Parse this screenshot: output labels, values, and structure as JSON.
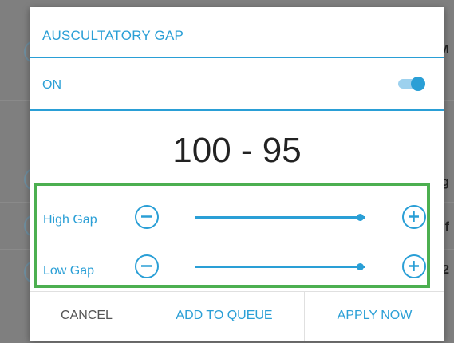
{
  "dialog": {
    "title": "AUSCULTATORY GAP",
    "toggle_label": "ON",
    "toggle_on": true,
    "value_text": "100 - 95",
    "high_gap": {
      "label": "High Gap",
      "level": 0.97
    },
    "low_gap": {
      "label": "Low Gap",
      "level": 0.97
    },
    "buttons": {
      "cancel": "CANCEL",
      "add_to_queue": "ADD TO QUEUE",
      "apply_now": "APPLY NOW"
    }
  },
  "background": {
    "peek_letters": [
      "M",
      "g",
      "f",
      "2"
    ]
  },
  "colors": {
    "accent": "#2a9fd6",
    "highlight_box": "#4caf50",
    "cancel_text": "#555555"
  }
}
